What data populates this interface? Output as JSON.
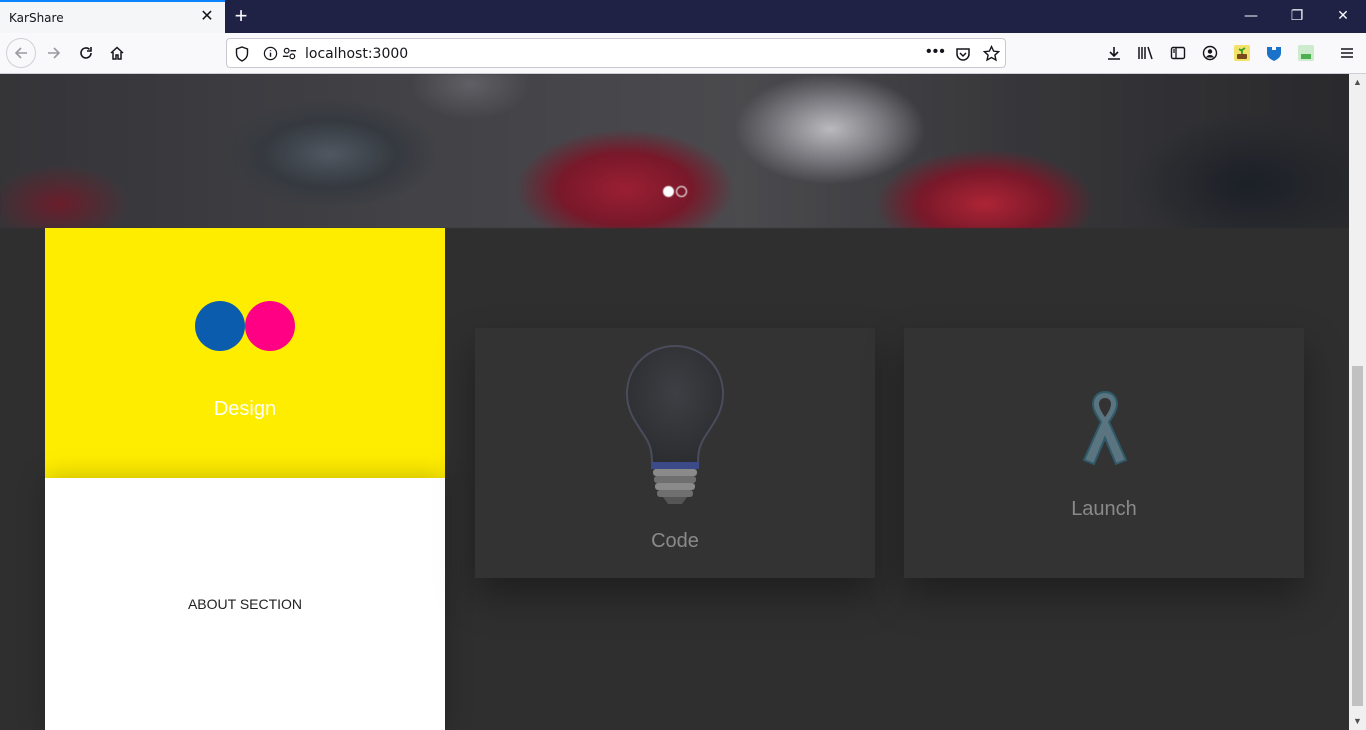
{
  "browser": {
    "tab_title": "KarShare",
    "tab_close": "✕",
    "new_tab": "+",
    "url": "localhost:3000",
    "window_controls": {
      "minimize": "—",
      "restore": "❐",
      "close": "✕"
    },
    "page_actions": "•••"
  },
  "hero": {
    "slides_count": 2,
    "active_slide": 1
  },
  "cards": {
    "design": {
      "label": "Design",
      "circle_left_color": "#0b5cad",
      "circle_right_color": "#ff0084",
      "bg_color": "#ffed00"
    },
    "about": {
      "label": "ABOUT SECTION"
    },
    "code": {
      "label": "Code"
    },
    "launch": {
      "label": "Launch"
    }
  }
}
